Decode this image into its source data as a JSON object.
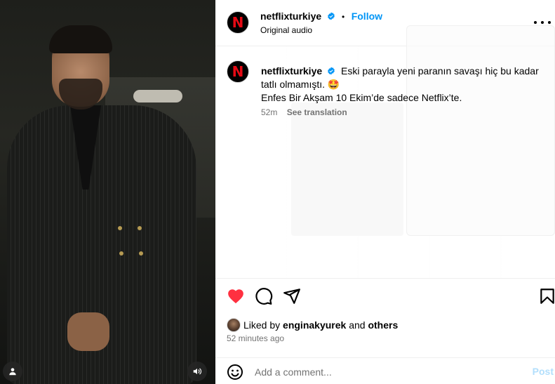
{
  "post": {
    "username": "netflixturkiye",
    "avatar_letter": "N",
    "follow_label": "Follow",
    "dot": "•",
    "audio": "Original audio",
    "caption_line1": "Eski parayla yeni paranın savaşı hiç bu kadar tatlı olmamıştı. 🤩",
    "caption_line2": "Enfes Bir Akşam 10 Ekim’de sadece Netflix’te.",
    "caption_age": "52m",
    "see_translation": "See translation"
  },
  "likes": {
    "prefix": "Liked by",
    "liker": "enginakyurek",
    "and": "and",
    "others": "others"
  },
  "timestamp": "52 minutes ago",
  "comment": {
    "placeholder": "Add a comment...",
    "post_label": "Post"
  },
  "colors": {
    "accent": "#0095f6",
    "like": "#ff3040",
    "netflix_red": "#e50914",
    "muted": "#737373"
  },
  "icons": [
    "user-tag-icon",
    "sound-icon",
    "verified-icon",
    "more-icon",
    "heart-icon",
    "comment-icon",
    "share-icon",
    "bookmark-icon",
    "emoji-icon"
  ]
}
